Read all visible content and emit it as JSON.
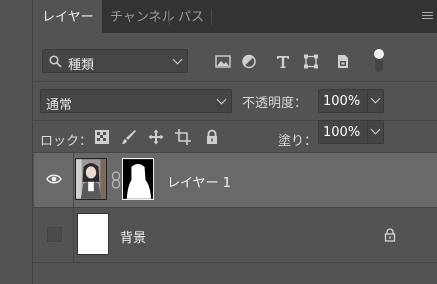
{
  "tabs": [
    {
      "label": "レイヤー",
      "active": true
    },
    {
      "label": "チャンネル",
      "active": false
    },
    {
      "label": "パス",
      "active": false
    }
  ],
  "filter": {
    "label": "種類",
    "icons": [
      "image-filter-icon",
      "adjustment-filter-icon",
      "type-filter-icon",
      "shape-filter-icon",
      "smart-object-filter-icon",
      "filter-toggle-icon"
    ]
  },
  "blend": {
    "mode": "通常",
    "opacity_label": "不透明度：",
    "opacity_value": "100%"
  },
  "lock": {
    "label": "ロック：",
    "icons": [
      "lock-transparent-pixels-icon",
      "lock-image-pixels-icon",
      "lock-position-icon",
      "lock-artboard-icon",
      "lock-all-icon"
    ],
    "fill_label": "塗り：",
    "fill_value": "100%"
  },
  "layers": [
    {
      "name": "レイヤー 1",
      "visible": true,
      "selected": true,
      "has_mask": true,
      "locked": false
    },
    {
      "name": "背景",
      "visible": false,
      "selected": false,
      "has_mask": false,
      "locked": true
    }
  ],
  "colors": {
    "panel": "#535353",
    "tabbar": "#333333",
    "selected_row": "#696969",
    "field": "#454545"
  }
}
